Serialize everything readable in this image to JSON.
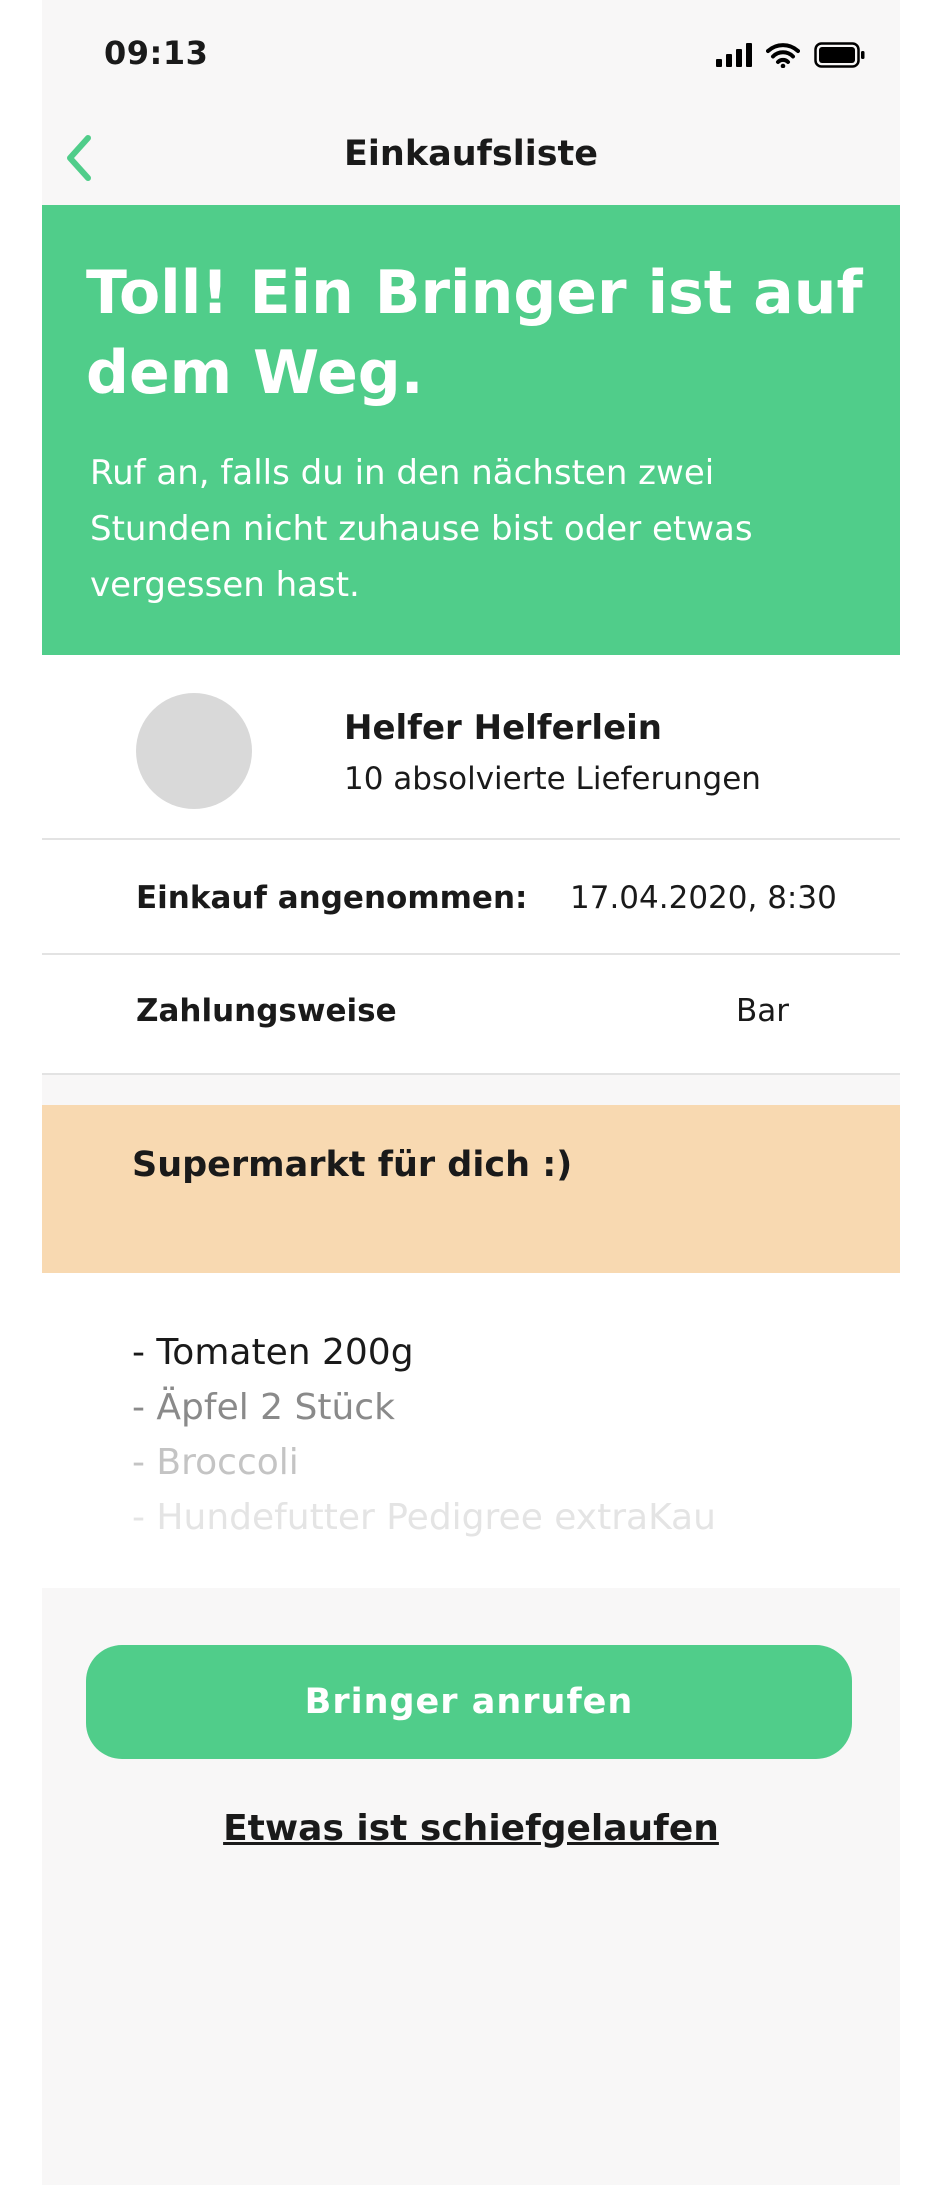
{
  "status_bar": {
    "time": "09:13"
  },
  "nav": {
    "title": "Einkaufsliste"
  },
  "hero": {
    "title": "Toll! Ein Bringer ist auf dem Weg.",
    "text": "Ruf an, falls du in den nächsten zwei Stunden nicht zuhause bist oder etwas vergessen hast."
  },
  "helper": {
    "name": "Helfer Helferlein",
    "deliveries": "10 absolvierte Lieferungen"
  },
  "details": {
    "accepted_label": "Einkauf angenommen:",
    "accepted_value": "17.04.2020, 8:30",
    "payment_label": "Zahlungsweise",
    "payment_value": "Bar"
  },
  "store": {
    "name": "Supermarkt für dich :)"
  },
  "shopping_list": {
    "items": [
      "- Tomaten 200g",
      "- Äpfel 2 Stück",
      "- Broccoli",
      "- Hundefutter Pedigree extraKau"
    ]
  },
  "actions": {
    "call_label": "Bringer anrufen",
    "problem_label": "Etwas ist schiefgelaufen"
  },
  "colors": {
    "accent_green": "#50cd8a",
    "store_orange": "#f8d9b1",
    "background": "#f8f7f7"
  },
  "icons": {
    "back": "chevron-left-icon",
    "signal": "cellular-signal-icon",
    "wifi": "wifi-icon",
    "battery": "battery-icon"
  }
}
